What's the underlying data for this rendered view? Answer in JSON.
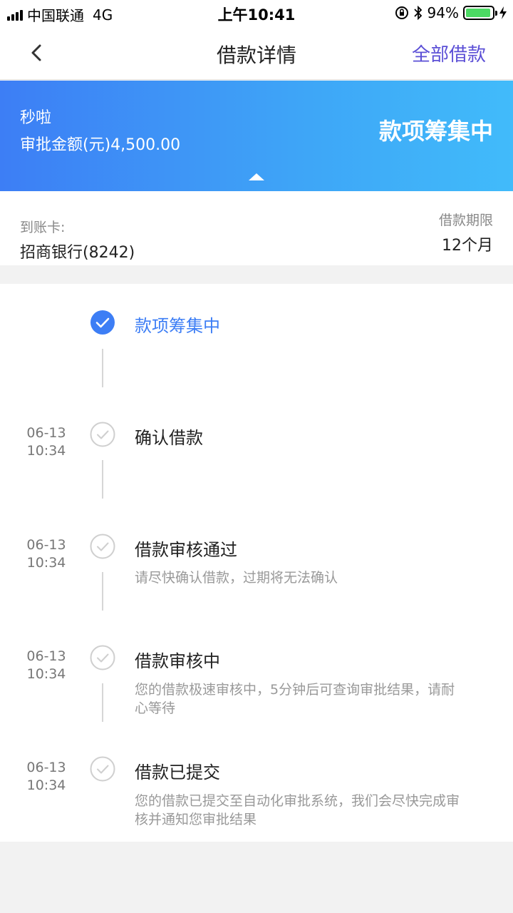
{
  "status_bar": {
    "carrier": "中国联通",
    "network": "4G",
    "time": "上午10:41",
    "battery": "94%",
    "battery_level": 0.94
  },
  "nav": {
    "back_icon": "chevron-left-icon",
    "title": "借款详情",
    "right_link": "全部借款"
  },
  "banner": {
    "product": "秒啦",
    "amount_text": "审批金额(元)4,500.00",
    "status": "款项筹集中",
    "colors": {
      "start": "#3d7ef5",
      "end": "#41bbfa"
    }
  },
  "info": {
    "card_label": "到账卡:",
    "card_value": "招商银行(8242)",
    "term_label": "借款期限",
    "term_value": "12个月"
  },
  "timeline": {
    "steps": [
      {
        "date": "",
        "time": "",
        "title": "款项筹集中",
        "desc": "",
        "state": "active"
      },
      {
        "date": "06-13",
        "time": "10:34",
        "title": "确认借款",
        "desc": "",
        "state": "done"
      },
      {
        "date": "06-13",
        "time": "10:34",
        "title": "借款审核通过",
        "desc": "请尽快确认借款，过期将无法确认",
        "state": "done"
      },
      {
        "date": "06-13",
        "time": "10:34",
        "title": "借款审核中",
        "desc": "您的借款极速审核中，5分钟后可查询审批结果，请耐心等待",
        "state": "done"
      },
      {
        "date": "06-13",
        "time": "10:34",
        "title": "借款已提交",
        "desc": "您的借款已提交至自动化审批系统，我们会尽快完成审核并通知您审批结果",
        "state": "done"
      }
    ]
  },
  "colors": {
    "accent": "#3d7ef5",
    "link": "#5b4fd6"
  }
}
